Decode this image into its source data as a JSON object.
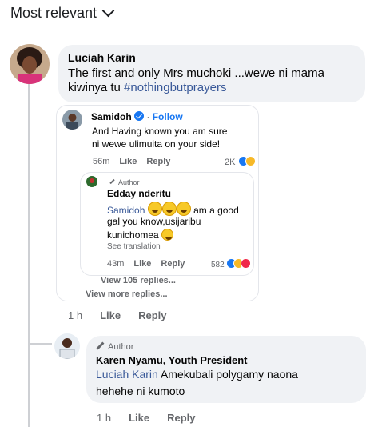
{
  "header": {
    "sort_label": "Most relevant"
  },
  "comment1": {
    "author": "Luciah Karin",
    "text_line1": "The first and only Mrs muchoki ...wewe ni mama",
    "text_line2_plain": "kiwinya tu ",
    "hashtag": "#nothingbutprayers",
    "time": "1 h",
    "like_label": "Like",
    "reply_label": "Reply",
    "view_more_replies": "View more replies..."
  },
  "reply1": {
    "author": "Samidoh",
    "follow_label": "Follow",
    "text_line1": "And Having known you am sure",
    "text_line2": "ni wewe ulimuita on your side!",
    "time": "56m",
    "like_label": "Like",
    "reply_label": "Reply",
    "reactions_count": "2K"
  },
  "reply2": {
    "badge": "Author",
    "author": "Edday nderitu",
    "mention": "Samidoh",
    "text_after_emojis": "am a good",
    "text_line2": "gal you know,usijaribu",
    "text_line3": "kunichomea",
    "see_translation": "See translation",
    "time": "43m",
    "like_label": "Like",
    "reply_label": "Reply",
    "reactions_count": "582",
    "view_replies": "View 105 replies..."
  },
  "comment2": {
    "badge": "Author",
    "author": "Karen Nyamu, Youth President",
    "mention": "Luciah Karin",
    "text_line1_rest": " Amekubali polygamy naona",
    "text_line2": "hehehe ni kumoto",
    "time": "1 h",
    "like_label": "Like",
    "reply_label": "Reply"
  },
  "colors": {
    "link": "#385898",
    "meta": "#65676b",
    "bubble": "#f0f2f5",
    "accent": "#1877f2"
  }
}
